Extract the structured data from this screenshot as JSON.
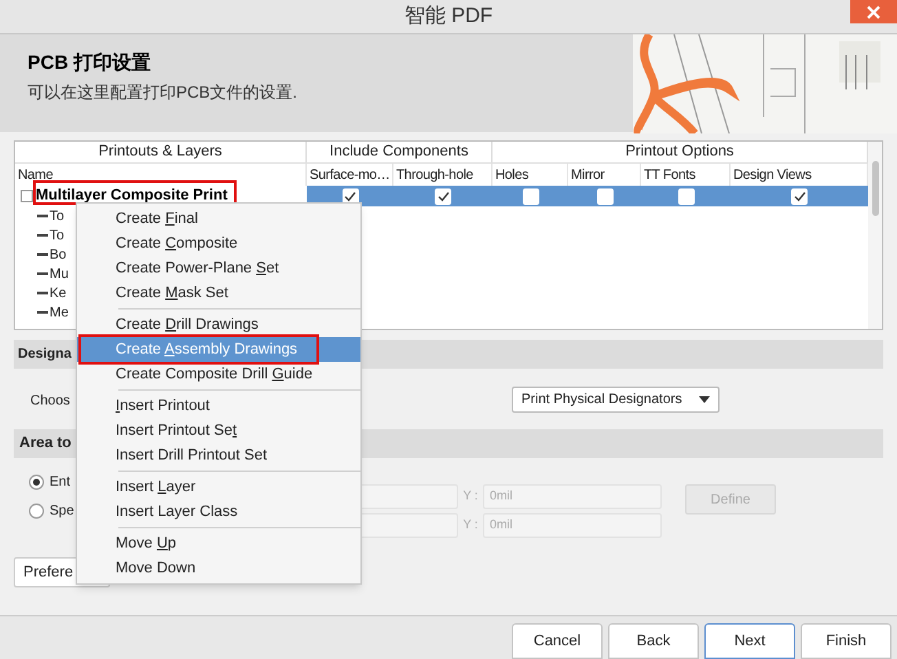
{
  "window": {
    "title": "智能 PDF"
  },
  "header": {
    "title": "PCB 打印设置",
    "subtitle": "可以在这里配置打印PCB文件的设置."
  },
  "table": {
    "groups": [
      "Printouts & Layers",
      "Include Components",
      "Printout Options"
    ],
    "columns": [
      "Name",
      "Surface-mo…",
      "Through-hole",
      "Holes",
      "Mirror",
      "TT Fonts",
      "Design Views"
    ],
    "rows": [
      {
        "name": "Multilayer Composite Print",
        "selected": true,
        "annotated": true,
        "checks": [
          true,
          true,
          false,
          false,
          false,
          true
        ]
      }
    ],
    "layers": [
      "To",
      "To",
      "Bo",
      "Mu",
      "Ke",
      "Me"
    ]
  },
  "designators": {
    "section": "Designa",
    "label": "Choos",
    "dropdown": "Print Physical Designators"
  },
  "area": {
    "section": "Area to",
    "options": [
      {
        "label": "Ent",
        "selected": true
      },
      {
        "label": "Spe",
        "selected": false
      }
    ],
    "coords": [
      {
        "y_label": "Y :",
        "y_value": "0mil"
      },
      {
        "y_label": "Y :",
        "y_value": "0mil"
      }
    ],
    "define": {
      "label": "Define",
      "disabled": true
    }
  },
  "preferences": "Prefere",
  "buttons": [
    {
      "label": "Cancel",
      "focused": false
    },
    {
      "label": "Back",
      "focused": false
    },
    {
      "label": "Next",
      "focused": true
    },
    {
      "label": "Finish",
      "focused": false
    }
  ],
  "menu": [
    {
      "kind": "item",
      "pre": "Create ",
      "key": "F",
      "post": "inal",
      "selected": false,
      "annotated": false
    },
    {
      "kind": "item",
      "pre": "Create ",
      "key": "C",
      "post": "omposite",
      "selected": false,
      "annotated": false
    },
    {
      "kind": "item",
      "pre": "Create Power-Plane ",
      "key": "S",
      "post": "et",
      "selected": false,
      "annotated": false
    },
    {
      "kind": "item",
      "pre": "Create ",
      "key": "M",
      "post": "ask Set",
      "selected": false,
      "annotated": false
    },
    {
      "kind": "separator"
    },
    {
      "kind": "item",
      "pre": "Create ",
      "key": "D",
      "post": "rill Drawings",
      "selected": false,
      "annotated": false
    },
    {
      "kind": "item",
      "pre": "Create ",
      "key": "A",
      "post": "ssembly Drawings",
      "selected": true,
      "annotated": true
    },
    {
      "kind": "item",
      "pre": "Create Composite Drill ",
      "key": "G",
      "post": "uide",
      "selected": false,
      "annotated": false
    },
    {
      "kind": "separator"
    },
    {
      "kind": "item",
      "key": "I",
      "post": "nsert Printout",
      "selected": false,
      "annotated": false
    },
    {
      "kind": "item",
      "pre": "Insert Printout Se",
      "key": "t",
      "selected": false,
      "annotated": false
    },
    {
      "kind": "item",
      "pre": "Insert Drill Printout Set",
      "selected": false,
      "annotated": false
    },
    {
      "kind": "separator"
    },
    {
      "kind": "item",
      "pre": "Insert ",
      "key": "L",
      "post": "ayer",
      "selected": false,
      "annotated": false
    },
    {
      "kind": "item",
      "pre": "Insert Layer Class",
      "selected": false,
      "annotated": false
    },
    {
      "kind": "separator"
    },
    {
      "kind": "item",
      "pre": "Move ",
      "key": "U",
      "post": "p",
      "selected": false,
      "annotated": false
    },
    {
      "kind": "item",
      "pre": "Move Down",
      "selected": false,
      "annotated": false
    }
  ]
}
